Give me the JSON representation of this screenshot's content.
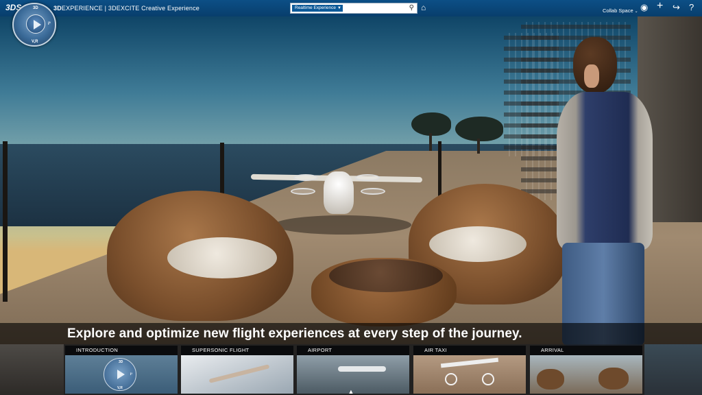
{
  "topbar": {
    "brand_bold": "3D",
    "brand_rest": "EXPERIENCE | 3DEXCITE Creative Experience",
    "search_scope": "Realtime Experience",
    "search_value": "",
    "collab_space": "Collab Space"
  },
  "compass": {
    "top": "3D",
    "right": "i³",
    "bottom": "V,R"
  },
  "caption": "Explore and optimize new flight experiences at every step of the journey.",
  "chapters": [
    {
      "title": "INTRODUCTION"
    },
    {
      "title": "SUPERSONIC FLIGHT"
    },
    {
      "title": "AIRPORT"
    },
    {
      "title": "AIR TAXI"
    },
    {
      "title": "ARRIVAL"
    }
  ],
  "colors": {
    "topbar": "#0c4f86",
    "search_scope_bg": "#0d5a99",
    "caption_bg": "#000000"
  }
}
